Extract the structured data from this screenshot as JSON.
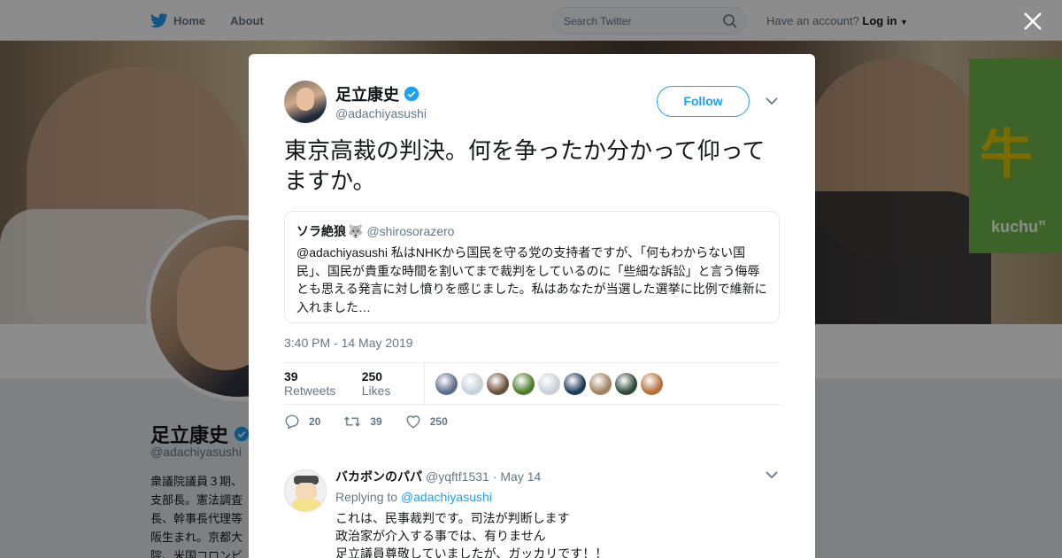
{
  "topbar": {
    "home_label": "Home",
    "about_label": "About",
    "search_placeholder": "Search Twitter",
    "account_prompt": "Have an account?",
    "login_label": "Log in"
  },
  "profile": {
    "name": "足立康史",
    "handle": "@adachiyasushi",
    "bio_lines": [
      "衆議院議員３期、",
      "支部長。憲法調査",
      "長、幹事長代理等",
      "阪生まれ。京都大",
      "院、米国コロンビ"
    ]
  },
  "banner": {
    "sign_char": "牛",
    "sign_text": "kuchu”"
  },
  "tweet": {
    "author_name": "足立康史",
    "author_handle": "@adachiyasushi",
    "follow_label": "Follow",
    "text": "東京高裁の判決。何を争ったか分かって仰ってますか。",
    "quote": {
      "name": "ソラ絶狼",
      "emoji": "🐺",
      "handle": "@shirosorazero",
      "text": "@adachiyasushi 私はNHKから国民を守る党の支持者ですが、「何もわからない国民」、国民が貴重な時間を割いてまで裁判をしているのに「些細な訴訟」と言う侮辱とも思える発言に対し憤りを感じました。私はあなたが当選した選挙に比例で維新に入れました…"
    },
    "timestamp": "3:40 PM - 14 May 2019",
    "retweets_count": "39",
    "retweets_label": "Retweets",
    "likes_count": "250",
    "likes_label": "Likes",
    "liker_colors": [
      "#5b6c8a",
      "#c8d0d8",
      "#6b4f3a",
      "#4d7d2a",
      "#c8d0d8",
      "#1b3b5a",
      "#a0825e",
      "#2d4a3a",
      "#b5703a"
    ],
    "actions": {
      "reply_count": "20",
      "retweet_count": "39",
      "like_count": "250"
    }
  },
  "reply": {
    "name": "バカボンのパパ",
    "handle": "@yqftf1531",
    "date": "· May 14",
    "replying_prefix": "Replying to",
    "replying_to": "@adachiyasushi",
    "lines": [
      "これは、民事裁判です。司法が判断します",
      "政治家が介入する事では、有りません",
      "足立議員尊敬していましたが、ガッカリです！！"
    ]
  },
  "colors": {
    "brand_blue": "#1da1f2",
    "text_secondary": "#657786"
  }
}
